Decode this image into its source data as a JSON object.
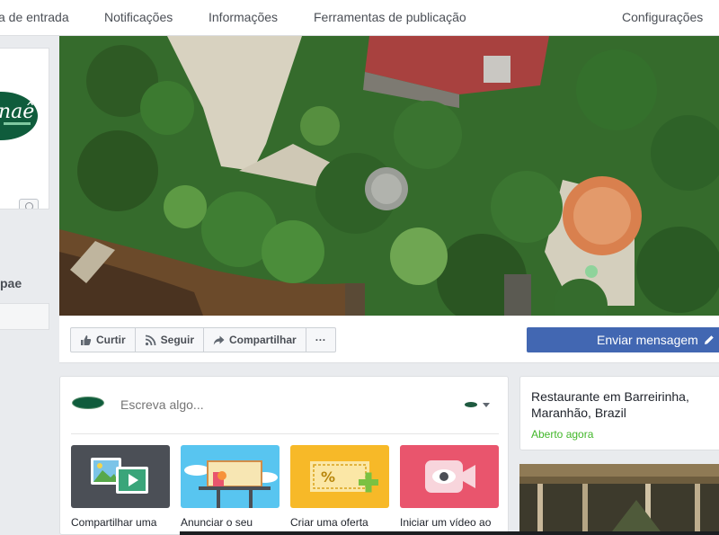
{
  "nav": {
    "items": [
      "a de entrada",
      "Notificações",
      "Informações",
      "Ferramentas de publicação",
      "Configurações"
    ]
  },
  "left": {
    "logo_text": "naê",
    "page_name": "pae"
  },
  "actions": {
    "like": "Curtir",
    "follow": "Seguir",
    "share": "Compartilhar",
    "more": "···",
    "send_message": "Enviar mensagem"
  },
  "composer": {
    "placeholder": "Escreva algo...",
    "tiles": [
      {
        "label": "Compartilhar uma",
        "color": "#4b4f56"
      },
      {
        "label": "Anunciar o seu",
        "color": "#58c5f0"
      },
      {
        "label": "Criar uma oferta",
        "color": "#f7b928"
      },
      {
        "label": "Iniciar um vídeo ao",
        "color": "#e9556d"
      }
    ]
  },
  "info": {
    "category": "Restaurante em Barreirinha, Maranhão, Brazil",
    "status": "Aberto agora"
  },
  "colors": {
    "brand_blue": "#4267b2",
    "logo_green": "#0f5c3c",
    "open_green": "#42b72a"
  }
}
